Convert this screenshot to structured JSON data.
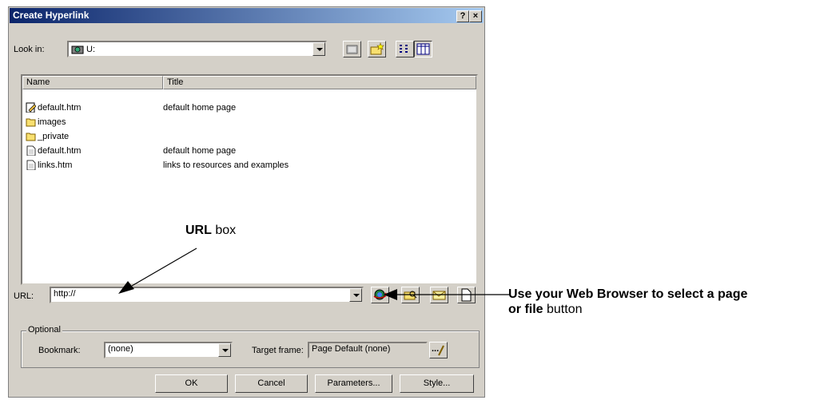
{
  "dialog": {
    "title": "Create Hyperlink",
    "help_button": "?",
    "close_button": "×"
  },
  "lookin": {
    "label": "Look in:",
    "value": "U:"
  },
  "columns": {
    "name": "Name",
    "title": "Title"
  },
  "files": [
    {
      "name": "default.htm",
      "title": "default home page",
      "icon": "html-edit-icon"
    },
    {
      "name": "images",
      "title": "",
      "icon": "folder-icon"
    },
    {
      "name": "_private",
      "title": "",
      "icon": "folder-icon"
    },
    {
      "name": "default.htm",
      "title": "default home page",
      "icon": "page-icon"
    },
    {
      "name": "links.htm",
      "title": "links to resources and examples",
      "icon": "page-icon"
    }
  ],
  "url": {
    "label": "URL:",
    "value": "http://"
  },
  "optional": {
    "label": "Optional",
    "bookmark_label": "Bookmark:",
    "bookmark_value": "(none)",
    "target_label": "Target frame:",
    "target_value": "Page Default (none)",
    "target_btn": "..."
  },
  "buttons": {
    "ok": "OK",
    "cancel": "Cancel",
    "parameters": "Parameters...",
    "style": "Style..."
  },
  "annotations": {
    "url_box_bold": "URL",
    "url_box_rest": " box",
    "browse_bold_1": "Use your Web Browser to select a page",
    "browse_bold_2": "or file",
    "browse_rest": " button"
  },
  "colors": {
    "title_start": "#0a246a",
    "title_end": "#a6caf0",
    "face": "#d4d0c8"
  }
}
